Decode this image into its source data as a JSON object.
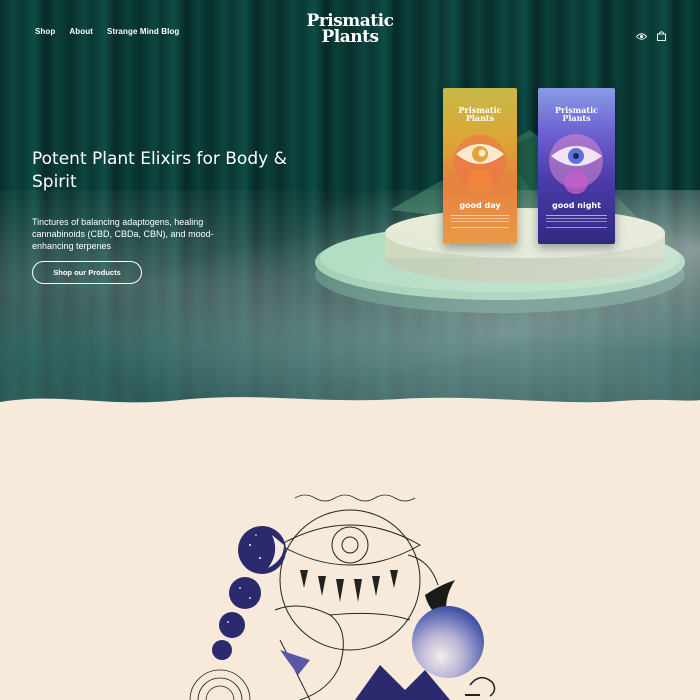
{
  "nav": {
    "links": [
      "Shop",
      "About",
      "Strange Mind Blog"
    ],
    "logo_line1": "Prismatic",
    "logo_line2": "Plants",
    "icons": [
      "eye-icon",
      "bag-icon"
    ]
  },
  "hero": {
    "title": "Potent Plant Elixirs for Body & Spirit",
    "subtitle": "Tinctures of balancing adaptogens, healing cannabinoids (CBD, CBDa, CBN), and mood-enhancing terpenes",
    "button": "Shop our Products"
  },
  "products": [
    {
      "brand_line1": "Prismatic",
      "brand_line2": "Plants",
      "name": "good day"
    },
    {
      "brand_line1": "Prismatic",
      "brand_line2": "Plants",
      "name": "good night"
    }
  ],
  "colors": {
    "curtain": "#0d4540",
    "cream": "#f7eadb",
    "pedestal": "#9fd8b0"
  }
}
